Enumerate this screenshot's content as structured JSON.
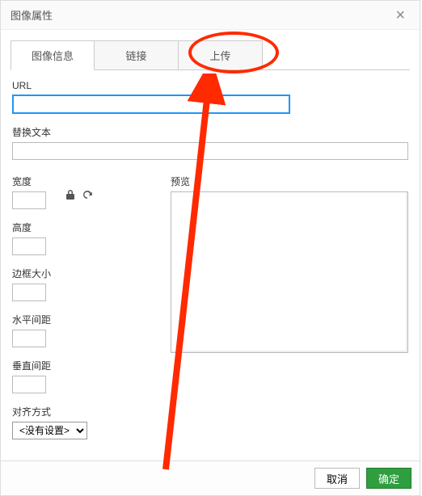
{
  "dialog": {
    "title": "图像属性",
    "close": "×"
  },
  "tabs": {
    "info": "图像信息",
    "link": "链接",
    "upload": "上传"
  },
  "fields": {
    "url_label": "URL",
    "url_value": "",
    "alt_label": "替换文本",
    "alt_value": "",
    "width_label": "宽度",
    "width_value": "",
    "height_label": "高度",
    "height_value": "",
    "border_label": "边框大小",
    "border_value": "",
    "hspace_label": "水平间距",
    "hspace_value": "",
    "vspace_label": "垂直间距",
    "vspace_value": "",
    "align_label": "对齐方式",
    "align_value": "<没有设置>",
    "preview_label": "预览"
  },
  "icons": {
    "lock": "lock-icon",
    "refresh": "refresh-icon"
  },
  "footer": {
    "cancel": "取消",
    "ok": "确定"
  },
  "annotations": {
    "ellipse_target_tab": "upload",
    "arrow_target": "preview-box"
  }
}
